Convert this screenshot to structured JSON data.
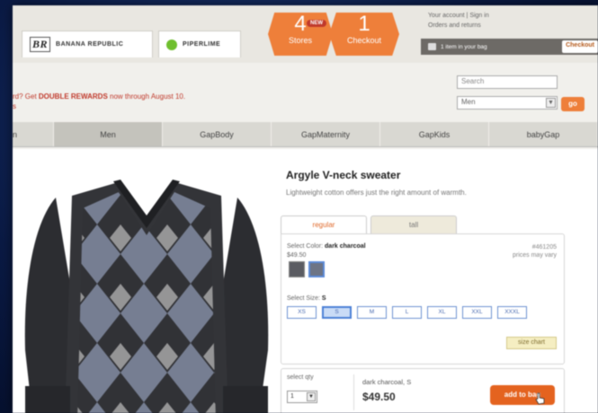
{
  "header": {
    "brands": [
      {
        "logo": "BR",
        "label": "BANANA REPUBLIC"
      },
      {
        "label": "PIPERLIME"
      }
    ],
    "stores": {
      "count": "4",
      "label": "Stores",
      "badge": "NEW"
    },
    "checkout": {
      "count": "1",
      "label": "Checkout"
    },
    "account_line1": "Your account | Sign in",
    "account_line2": "Orders and returns",
    "bag_text": "1 item in your bag",
    "checkout_button": "Checkout"
  },
  "promo": {
    "prefix": "rd? Get ",
    "highlight": "DOUBLE REWARDS",
    "suffix": " now through August 10.",
    "line2": "s"
  },
  "search": {
    "placeholder": "Search",
    "department": "Men",
    "go": "go"
  },
  "nav": {
    "items": [
      {
        "label": "n"
      },
      {
        "label": "Men"
      },
      {
        "label": "GapBody"
      },
      {
        "label": "GapMaternity"
      },
      {
        "label": "GapKids"
      },
      {
        "label": "babyGap"
      }
    ]
  },
  "product": {
    "title": "Argyle V-neck sweater",
    "description": "Lightweight cotton offers just the right amount of warmth.",
    "tabs": {
      "regular": "regular",
      "tall": "tall"
    },
    "color_label": "Select Color: ",
    "color_value": "dark charcoal",
    "price_small": "$49.50",
    "item_number": "#461205",
    "prices_vary": "prices may vary",
    "size_label": "Select Size: ",
    "size_value": "S",
    "sizes": [
      "XS",
      "S",
      "M",
      "L",
      "XL",
      "XXL",
      "XXXL"
    ],
    "selected_size": "S",
    "size_chart": "size chart",
    "qty_label": "select qty",
    "qty_value": "1",
    "summary": "dark charcoal, S",
    "price": "$49.50",
    "add_to_bag": "add to bag"
  },
  "colors": {
    "accent": "#ee7f3a",
    "promo": "#c0392b",
    "selected": "#4a7fd6"
  }
}
